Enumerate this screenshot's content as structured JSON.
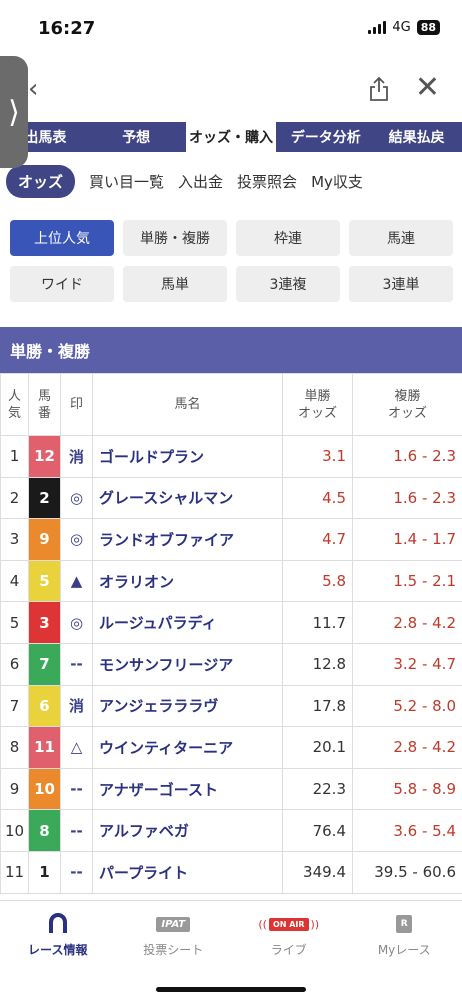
{
  "status": {
    "time": "16:27",
    "network": "4G",
    "battery": "88"
  },
  "main_tabs": [
    {
      "label": "出馬表",
      "active": false
    },
    {
      "label": "予想",
      "active": false
    },
    {
      "label": "オッズ・購入",
      "active": true
    },
    {
      "label": "データ分析",
      "active": false
    },
    {
      "label": "結果払戻",
      "active": false
    }
  ],
  "sub_tabs": [
    {
      "label": "オッズ",
      "active": true
    },
    {
      "label": "買い目一覧",
      "active": false
    },
    {
      "label": "入出金",
      "active": false
    },
    {
      "label": "投票照会",
      "active": false
    },
    {
      "label": "My収支",
      "active": false
    }
  ],
  "filters": [
    {
      "label": "上位人気",
      "active": true
    },
    {
      "label": "単勝・複勝",
      "active": false
    },
    {
      "label": "枠連",
      "active": false
    },
    {
      "label": "馬連",
      "active": false
    },
    {
      "label": "ワイド",
      "active": false
    },
    {
      "label": "馬単",
      "active": false
    },
    {
      "label": "3連複",
      "active": false
    },
    {
      "label": "3連単",
      "active": false
    }
  ],
  "section_title": "単勝・複勝",
  "table": {
    "headers": {
      "rank": [
        "人",
        "気"
      ],
      "number": [
        "馬",
        "番"
      ],
      "mark": "印",
      "name": "馬名",
      "win": [
        "単勝",
        "オッズ"
      ],
      "place": [
        "複勝",
        "オッズ"
      ]
    },
    "rows": [
      {
        "rank": "1",
        "num": "12",
        "num_bg": "#e0606e",
        "num_fg": "#ffffff",
        "mark": "消",
        "name": "ゴールドプラン",
        "win": "3.1",
        "win_red": true,
        "place": "1.6 - 2.3",
        "place_red": true
      },
      {
        "rank": "2",
        "num": "2",
        "num_bg": "#1a1a1a",
        "num_fg": "#ffffff",
        "mark": "◎",
        "name": "グレースシャルマン",
        "win": "4.5",
        "win_red": true,
        "place": "1.6 - 2.3",
        "place_red": true
      },
      {
        "rank": "3",
        "num": "9",
        "num_bg": "#ea8a2c",
        "num_fg": "#ffffff",
        "mark": "◎",
        "name": "ランドオブファイア",
        "win": "4.7",
        "win_red": true,
        "place": "1.4 - 1.7",
        "place_red": true
      },
      {
        "rank": "4",
        "num": "5",
        "num_bg": "#e9d23c",
        "num_fg": "#ffffff",
        "mark": "▲",
        "name": "オラリオン",
        "win": "5.8",
        "win_red": true,
        "place": "1.5 - 2.1",
        "place_red": true
      },
      {
        "rank": "5",
        "num": "3",
        "num_bg": "#dd3535",
        "num_fg": "#ffffff",
        "mark": "◎",
        "name": "ルージュパラディ",
        "win": "11.7",
        "win_red": false,
        "place": "2.8 - 4.2",
        "place_red": true
      },
      {
        "rank": "6",
        "num": "7",
        "num_bg": "#3aa95a",
        "num_fg": "#ffffff",
        "mark": "--",
        "name": "モンサンフリージア",
        "win": "12.8",
        "win_red": false,
        "place": "3.2 - 4.7",
        "place_red": true
      },
      {
        "rank": "7",
        "num": "6",
        "num_bg": "#e9d23c",
        "num_fg": "#ffffff",
        "mark": "消",
        "name": "アンジェラララヴ",
        "win": "17.8",
        "win_red": false,
        "place": "5.2 - 8.0",
        "place_red": true
      },
      {
        "rank": "8",
        "num": "11",
        "num_bg": "#e0606e",
        "num_fg": "#ffffff",
        "mark": "△",
        "name": "ウインティターニア",
        "win": "20.1",
        "win_red": false,
        "place": "2.8 - 4.2",
        "place_red": true
      },
      {
        "rank": "9",
        "num": "10",
        "num_bg": "#ea8a2c",
        "num_fg": "#ffffff",
        "mark": "--",
        "name": "アナザーゴースト",
        "win": "22.3",
        "win_red": false,
        "place": "5.8 - 8.9",
        "place_red": true
      },
      {
        "rank": "10",
        "num": "8",
        "num_bg": "#3aa95a",
        "num_fg": "#ffffff",
        "mark": "--",
        "name": "アルファベガ",
        "win": "76.4",
        "win_red": false,
        "place": "3.6 - 5.4",
        "place_red": true
      },
      {
        "rank": "11",
        "num": "1",
        "num_bg": "#ffffff",
        "num_fg": "#222222",
        "mark": "--",
        "name": "パープライト",
        "win": "349.4",
        "win_red": false,
        "place": "39.5 - 60.6",
        "place_red": false
      }
    ]
  },
  "bottom_nav": [
    {
      "label": "レース情報",
      "icon": "horseshoe-icon",
      "active": true
    },
    {
      "label": "投票シート",
      "icon": "ipat-icon",
      "icon_text": "IPAT",
      "active": false
    },
    {
      "label": "ライブ",
      "icon": "on-air-icon",
      "icon_text": "ON AIR",
      "active": false
    },
    {
      "label": "Myレース",
      "icon": "my-race-icon",
      "icon_text": "R",
      "active": false
    }
  ]
}
